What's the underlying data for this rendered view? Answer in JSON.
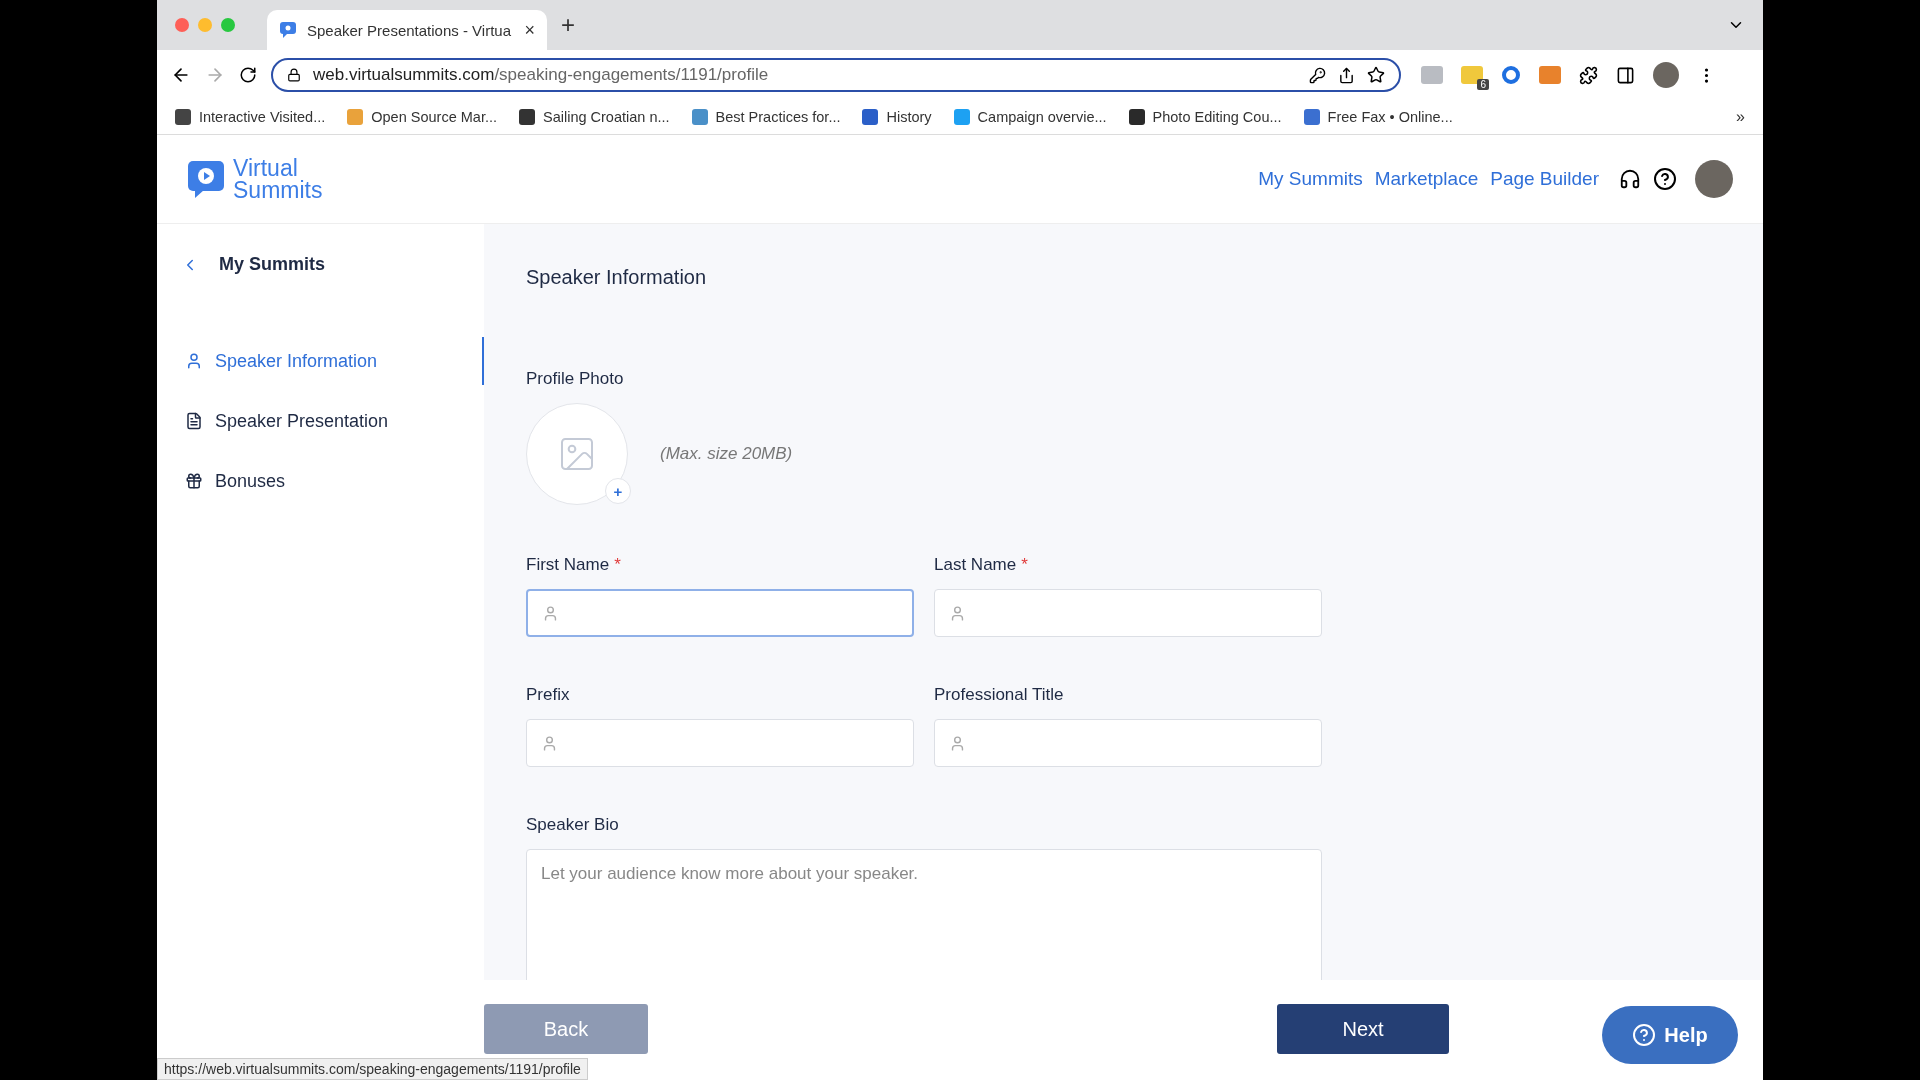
{
  "browser": {
    "tab_title": "Speaker Presentations - Virtua",
    "tab_close": "×",
    "new_tab": "+",
    "url_host": "web.virtualsummits.com",
    "url_path": "/speaking-engagements/1191/profile",
    "extension_badge": "6",
    "bookmarks": [
      "Interactive Visited...",
      "Open Source Mar...",
      "Sailing Croatian n...",
      "Best Practices for...",
      "History",
      "Campaign overvie...",
      "Photo Editing Cou...",
      "Free Fax • Online..."
    ],
    "bookmarks_more": "»"
  },
  "header": {
    "logo_line1": "Virtual",
    "logo_line2": "Summits",
    "nav": [
      "My Summits",
      "Marketplace",
      "Page Builder"
    ]
  },
  "sidebar": {
    "back_label": "My Summits",
    "items": [
      {
        "label": "Speaker Information",
        "kind": "person",
        "selected": true
      },
      {
        "label": "Speaker Presentation",
        "kind": "document",
        "selected": false
      },
      {
        "label": "Bonuses",
        "kind": "gift",
        "selected": false
      }
    ]
  },
  "form": {
    "title": "Speaker Information",
    "photo_label": "Profile Photo",
    "photo_hint": "(Max. size 20MB)",
    "photo_add": "+",
    "required_mark": "*",
    "rows": [
      [
        {
          "label": "First Name",
          "required": true,
          "focused": true
        },
        {
          "label": "Last Name",
          "required": true,
          "focused": false
        }
      ],
      [
        {
          "label": "Prefix",
          "required": false,
          "focused": false
        },
        {
          "label": "Professional Title",
          "required": false,
          "focused": false
        }
      ]
    ],
    "bio_label": "Speaker Bio",
    "bio_placeholder": "Let your audience know more about your speaker."
  },
  "footer": {
    "back": "Back",
    "next": "Next",
    "help": "Help"
  },
  "status_url": "https://web.virtualsummits.com/speaking-engagements/1191/profile"
}
